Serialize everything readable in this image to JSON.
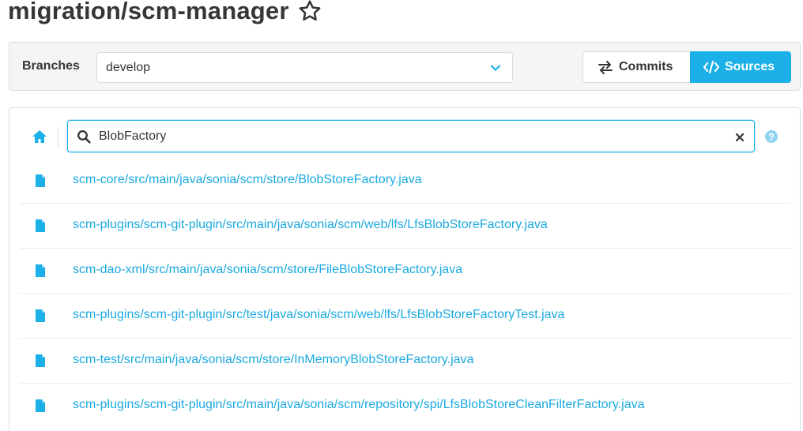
{
  "header": {
    "repo_title": "migration/scm-manager",
    "star_icon": "star-outline-icon"
  },
  "branch_bar": {
    "label": "Branches",
    "selected_branch": "develop",
    "commits_label": "Commits",
    "sources_label": "Sources",
    "active_view": "Sources"
  },
  "search": {
    "value": "BlobFactory",
    "placeholder": ""
  },
  "results": [
    {
      "path": "scm-core/src/main/java/sonia/scm/store/BlobStoreFactory.java",
      "icon": "file-icon"
    },
    {
      "path": "scm-plugins/scm-git-plugin/src/main/java/sonia/scm/web/lfs/LfsBlobStoreFactory.java",
      "icon": "file-icon"
    },
    {
      "path": "scm-dao-xml/src/main/java/sonia/scm/store/FileBlobStoreFactory.java",
      "icon": "file-icon"
    },
    {
      "path": "scm-plugins/scm-git-plugin/src/test/java/sonia/scm/web/lfs/LfsBlobStoreFactoryTest.java",
      "icon": "file-icon"
    },
    {
      "path": "scm-test/src/main/java/sonia/scm/store/InMemoryBlobStoreFactory.java",
      "icon": "file-icon"
    },
    {
      "path": "scm-plugins/scm-git-plugin/src/main/java/sonia/scm/repository/spi/LfsBlobStoreCleanFilterFactory.java",
      "icon": "file-icon"
    }
  ],
  "colors": {
    "accent": "#1cb0e8",
    "link": "#1ba9e0",
    "text": "#363636",
    "border": "#dbdbdb",
    "bar_bg": "#f5f5f5"
  }
}
